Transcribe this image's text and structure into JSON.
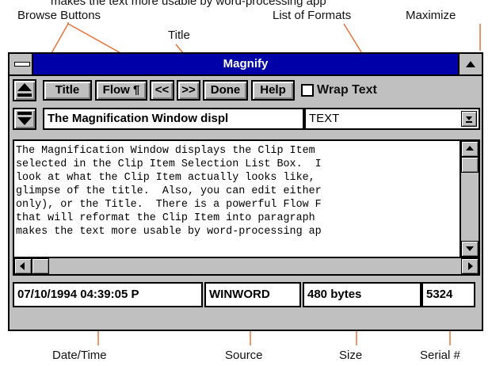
{
  "top_partial_text": "makes the text more usable by word-processing app",
  "callouts": {
    "browse_buttons": "Browse Buttons",
    "list_of_formats": "List of Formats",
    "maximize": "Maximize",
    "title": "Title",
    "date_time": "Date/Time",
    "source": "Source",
    "size": "Size",
    "serial": "Serial #"
  },
  "window": {
    "title": "Magnify",
    "toolbar": {
      "title_btn": "Title",
      "flow_btn": "Flow ¶",
      "prev_btn": "<<",
      "next_btn": ">>",
      "done_btn": "Done",
      "help_btn": "Help",
      "wrap_label": "Wrap Text",
      "wrap_checked": false
    },
    "title_field_value": "The Magnification Window displ",
    "format_select_value": "TEXT",
    "content_lines": [
      "The Magnification Window displays the Clip Item",
      "selected in the Clip Item Selection List Box.  I",
      "look at what the Clip Item actually looks like,",
      "glimpse of the title.  Also, you can edit either",
      "only), or the Title.  There is a powerful Flow F",
      "that will reformat the Clip Item into paragraph",
      "makes the text more usable by word-processing ap"
    ],
    "status": {
      "datetime": "07/10/1994 04:39:05 P",
      "source": "WINWORD",
      "size": "480 bytes",
      "serial": "5324"
    }
  }
}
